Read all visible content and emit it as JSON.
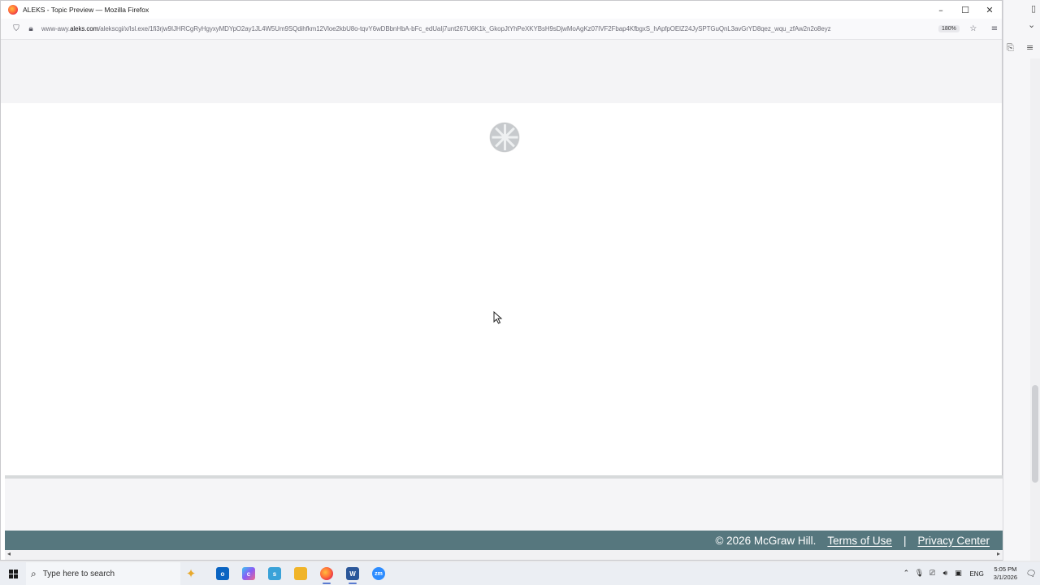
{
  "window": {
    "title": "ALEKS - Topic Preview — Mozilla Firefox",
    "controls": {
      "minimize": "–",
      "maximize": "☐",
      "close": "✕"
    }
  },
  "urlbar": {
    "url_prefix": "www-awy.",
    "url_domain": "aleks.com",
    "url_path": "/alekscgi/x/Isl.exe/1fi3rjw9IJHRCgRyHgyxyMDYpO2ay1JL4W5Um9SQdihfkm12Vloe2kbU8o-tqvY6wDBbnHbA-bFc_edUaIj7unt267U6K1k_GkopJtYhPeXKYBsH9sDjwMoAgKz07IVF2Fbap4KfbgxS_hApfpOElZ24JySPTGuQnL3avGrYD8qez_wqu_zfAw2n2o8eyz",
    "zoom": "180%"
  },
  "footer": {
    "copyright": "© 2026 McGraw Hill.",
    "terms": "Terms of Use",
    "separator": "|",
    "privacy": "Privacy Center"
  },
  "taskbar": {
    "search_placeholder": "Type here to search",
    "language": "ENG",
    "time": "5:05 PM",
    "date": "3/1/2026",
    "apps": [
      {
        "name": "outlook",
        "label": "o",
        "color": "#0a64c2"
      },
      {
        "name": "copilot",
        "label": "c",
        "color": "#8a5cf6"
      },
      {
        "name": "snipping-tool",
        "label": "s",
        "color": "#3aa2d8"
      },
      {
        "name": "file-explorer",
        "label": "",
        "color": "#f0b429"
      },
      {
        "name": "firefox",
        "label": "",
        "color": "#ff6f3c"
      },
      {
        "name": "word",
        "label": "W",
        "color": "#2b579a"
      },
      {
        "name": "zoom",
        "label": "zm",
        "color": "#2d8cff"
      }
    ]
  },
  "colors": {
    "footer_bg": "#56777e",
    "accent": "#5a7bd0"
  }
}
